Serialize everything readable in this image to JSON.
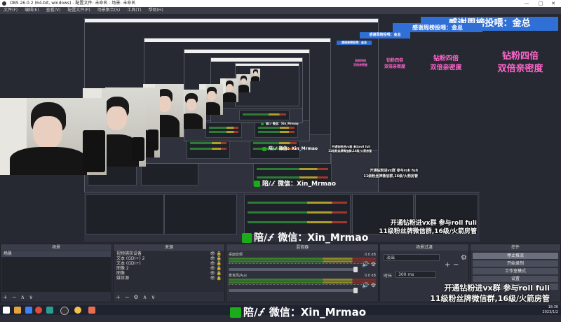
{
  "window": {
    "title": "OBS 26.0.2 (64-bit, windows) - 配置文件: 未命名 - 场景: 未命名",
    "controls": [
      "—",
      "□",
      "✕"
    ]
  },
  "menu": [
    "文件(F)",
    "编辑(E)",
    "查看(V)",
    "配置文件(P)",
    "场景集合(S)",
    "工具(T)",
    "帮助(H)"
  ],
  "overlay": {
    "thanks": "感谢周榜投喂：金总",
    "diamond_line1": "钻粉四倍",
    "diamond_line2": "双倍亲密度",
    "wechat_full": "陪/🝡 微信：Xin_Mrmao",
    "promo_line1": "开通钻粉进vx群 参与roll fuli",
    "promo_line2": "11级粉丝牌微信群,16级/火箭房管"
  },
  "docks": {
    "scenes": {
      "title": "场景",
      "items": [
        "场景"
      ],
      "footer": [
        "+",
        "−",
        "∧",
        "∨"
      ]
    },
    "sources": {
      "title": "来源",
      "items": [
        "视频捕获设备",
        "文本 (GDI+) 2",
        "文本 (GDI+)",
        "图像 2",
        "图像",
        "媒体源"
      ],
      "footer": [
        "+",
        "−",
        "⚙",
        "∧",
        "∨"
      ]
    },
    "mixer": {
      "title": "混音器",
      "channels": [
        {
          "name": "桌面音频",
          "db": "0.0 dB"
        },
        {
          "name": "麦克风/Aux",
          "db": "0.0 dB"
        }
      ]
    },
    "transitions": {
      "title": "场景过渡",
      "selected": "淡出",
      "duration_label": "时长",
      "duration": "300 ms",
      "buttons": [
        "+",
        "−",
        "⚙"
      ]
    },
    "controls": {
      "title": "控件",
      "buttons": [
        "停止推流",
        "开始录制",
        "工作室模式",
        "设置",
        "退出"
      ]
    }
  },
  "taskbar": {
    "time": "18:36",
    "date": "2023/1/2"
  },
  "colors": {
    "accent_pink": "#ff66cc",
    "banner_blue": "#2f6fd6",
    "wechat_green": "#1aad19",
    "obs_panel": "#2f323c"
  }
}
